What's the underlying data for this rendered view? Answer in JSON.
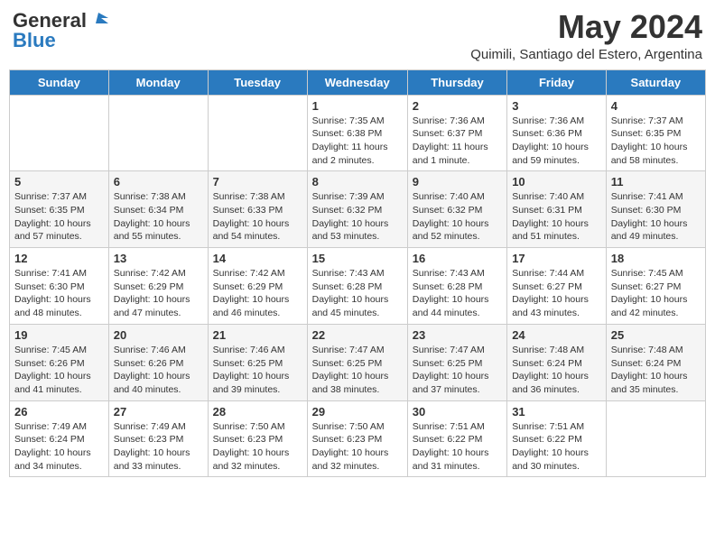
{
  "header": {
    "logo_general": "General",
    "logo_blue": "Blue",
    "month_year": "May 2024",
    "location": "Quimili, Santiago del Estero, Argentina"
  },
  "days_of_week": [
    "Sunday",
    "Monday",
    "Tuesday",
    "Wednesday",
    "Thursday",
    "Friday",
    "Saturday"
  ],
  "weeks": [
    [
      {
        "day": "",
        "info": ""
      },
      {
        "day": "",
        "info": ""
      },
      {
        "day": "",
        "info": ""
      },
      {
        "day": "1",
        "info": "Sunrise: 7:35 AM\nSunset: 6:38 PM\nDaylight: 11 hours\nand 2 minutes."
      },
      {
        "day": "2",
        "info": "Sunrise: 7:36 AM\nSunset: 6:37 PM\nDaylight: 11 hours\nand 1 minute."
      },
      {
        "day": "3",
        "info": "Sunrise: 7:36 AM\nSunset: 6:36 PM\nDaylight: 10 hours\nand 59 minutes."
      },
      {
        "day": "4",
        "info": "Sunrise: 7:37 AM\nSunset: 6:35 PM\nDaylight: 10 hours\nand 58 minutes."
      }
    ],
    [
      {
        "day": "5",
        "info": "Sunrise: 7:37 AM\nSunset: 6:35 PM\nDaylight: 10 hours\nand 57 minutes."
      },
      {
        "day": "6",
        "info": "Sunrise: 7:38 AM\nSunset: 6:34 PM\nDaylight: 10 hours\nand 55 minutes."
      },
      {
        "day": "7",
        "info": "Sunrise: 7:38 AM\nSunset: 6:33 PM\nDaylight: 10 hours\nand 54 minutes."
      },
      {
        "day": "8",
        "info": "Sunrise: 7:39 AM\nSunset: 6:32 PM\nDaylight: 10 hours\nand 53 minutes."
      },
      {
        "day": "9",
        "info": "Sunrise: 7:40 AM\nSunset: 6:32 PM\nDaylight: 10 hours\nand 52 minutes."
      },
      {
        "day": "10",
        "info": "Sunrise: 7:40 AM\nSunset: 6:31 PM\nDaylight: 10 hours\nand 51 minutes."
      },
      {
        "day": "11",
        "info": "Sunrise: 7:41 AM\nSunset: 6:30 PM\nDaylight: 10 hours\nand 49 minutes."
      }
    ],
    [
      {
        "day": "12",
        "info": "Sunrise: 7:41 AM\nSunset: 6:30 PM\nDaylight: 10 hours\nand 48 minutes."
      },
      {
        "day": "13",
        "info": "Sunrise: 7:42 AM\nSunset: 6:29 PM\nDaylight: 10 hours\nand 47 minutes."
      },
      {
        "day": "14",
        "info": "Sunrise: 7:42 AM\nSunset: 6:29 PM\nDaylight: 10 hours\nand 46 minutes."
      },
      {
        "day": "15",
        "info": "Sunrise: 7:43 AM\nSunset: 6:28 PM\nDaylight: 10 hours\nand 45 minutes."
      },
      {
        "day": "16",
        "info": "Sunrise: 7:43 AM\nSunset: 6:28 PM\nDaylight: 10 hours\nand 44 minutes."
      },
      {
        "day": "17",
        "info": "Sunrise: 7:44 AM\nSunset: 6:27 PM\nDaylight: 10 hours\nand 43 minutes."
      },
      {
        "day": "18",
        "info": "Sunrise: 7:45 AM\nSunset: 6:27 PM\nDaylight: 10 hours\nand 42 minutes."
      }
    ],
    [
      {
        "day": "19",
        "info": "Sunrise: 7:45 AM\nSunset: 6:26 PM\nDaylight: 10 hours\nand 41 minutes."
      },
      {
        "day": "20",
        "info": "Sunrise: 7:46 AM\nSunset: 6:26 PM\nDaylight: 10 hours\nand 40 minutes."
      },
      {
        "day": "21",
        "info": "Sunrise: 7:46 AM\nSunset: 6:25 PM\nDaylight: 10 hours\nand 39 minutes."
      },
      {
        "day": "22",
        "info": "Sunrise: 7:47 AM\nSunset: 6:25 PM\nDaylight: 10 hours\nand 38 minutes."
      },
      {
        "day": "23",
        "info": "Sunrise: 7:47 AM\nSunset: 6:25 PM\nDaylight: 10 hours\nand 37 minutes."
      },
      {
        "day": "24",
        "info": "Sunrise: 7:48 AM\nSunset: 6:24 PM\nDaylight: 10 hours\nand 36 minutes."
      },
      {
        "day": "25",
        "info": "Sunrise: 7:48 AM\nSunset: 6:24 PM\nDaylight: 10 hours\nand 35 minutes."
      }
    ],
    [
      {
        "day": "26",
        "info": "Sunrise: 7:49 AM\nSunset: 6:24 PM\nDaylight: 10 hours\nand 34 minutes."
      },
      {
        "day": "27",
        "info": "Sunrise: 7:49 AM\nSunset: 6:23 PM\nDaylight: 10 hours\nand 33 minutes."
      },
      {
        "day": "28",
        "info": "Sunrise: 7:50 AM\nSunset: 6:23 PM\nDaylight: 10 hours\nand 32 minutes."
      },
      {
        "day": "29",
        "info": "Sunrise: 7:50 AM\nSunset: 6:23 PM\nDaylight: 10 hours\nand 32 minutes."
      },
      {
        "day": "30",
        "info": "Sunrise: 7:51 AM\nSunset: 6:22 PM\nDaylight: 10 hours\nand 31 minutes."
      },
      {
        "day": "31",
        "info": "Sunrise: 7:51 AM\nSunset: 6:22 PM\nDaylight: 10 hours\nand 30 minutes."
      },
      {
        "day": "",
        "info": ""
      }
    ]
  ]
}
